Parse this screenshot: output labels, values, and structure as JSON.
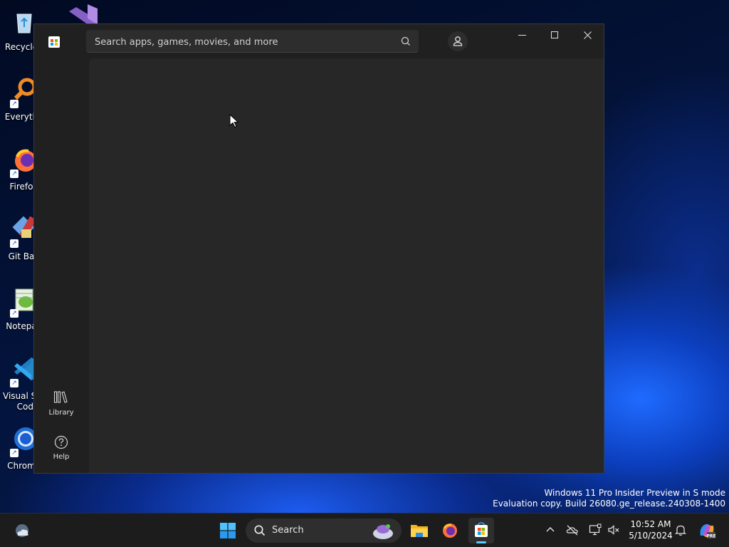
{
  "desktop": {
    "icons": [
      {
        "label": "Recycle"
      },
      {
        "label": "Everyth"
      },
      {
        "label": "Firefo"
      },
      {
        "label": "Git Ba"
      },
      {
        "label": "Notepa"
      },
      {
        "label": "Visual St"
      },
      {
        "label": "Cod"
      },
      {
        "label": "Chrom"
      }
    ]
  },
  "window": {
    "app_icon": "microsoft-store-icon",
    "search": {
      "placeholder": "Search apps, games, movies, and more",
      "value": ""
    },
    "sidebar": {
      "items": [
        {
          "label": "Library",
          "icon": "library-icon"
        },
        {
          "label": "Help",
          "icon": "help-icon"
        }
      ]
    }
  },
  "watermark": {
    "line1": "Windows 11 Pro Insider Preview in S mode",
    "line2": "Evaluation copy. Build 26080.ge_release.240308-1400"
  },
  "taskbar": {
    "search_label": "Search",
    "clock": {
      "time": "10:52 AM",
      "date": "5/10/2024"
    }
  },
  "colors": {
    "window_bg": "#202020",
    "content_bg": "#272727",
    "taskbar_bg": "#1c1c1c",
    "accent": "#0078d4"
  }
}
